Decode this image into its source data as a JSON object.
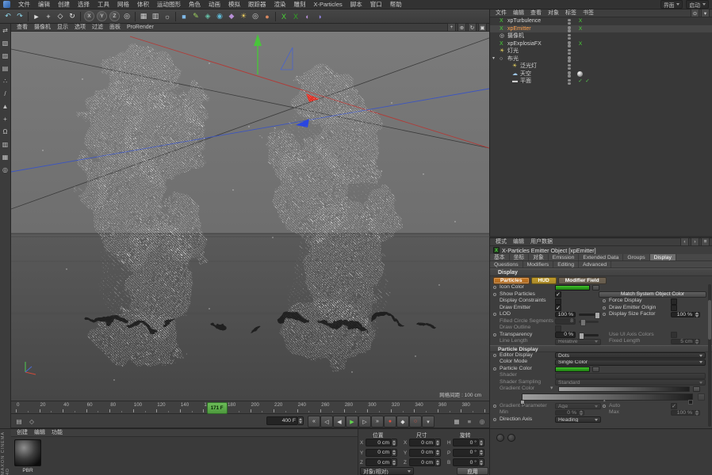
{
  "branding": "MAXON CINEMA 4D",
  "menubar": {
    "items": [
      "文件",
      "编辑",
      "创建",
      "选择",
      "工具",
      "网格",
      "体积",
      "运动图形",
      "角色",
      "动画",
      "模拟",
      "跟踪器",
      "渲染",
      "雕刻",
      "X-Particles",
      "脚本",
      "窗口",
      "帮助"
    ],
    "right": [
      {
        "label": "界面"
      },
      {
        "label": "启动"
      }
    ]
  },
  "toolbar": {
    "icons": [
      {
        "name": "undo-icon",
        "glyph": "↶",
        "color": "#8ed7ec"
      },
      {
        "name": "redo-icon",
        "glyph": "↷",
        "color": "#8ed7ec"
      },
      {
        "sep": true
      },
      {
        "name": "live-selection-icon",
        "glyph": "►",
        "color": "#dcdcdc"
      },
      {
        "name": "move-tool-icon",
        "glyph": "+",
        "color": "#e6e6e6"
      },
      {
        "name": "scale-tool-icon",
        "glyph": "◇",
        "color": "#e6e6e6"
      },
      {
        "name": "rotate-tool-icon",
        "glyph": "↻",
        "color": "#e6e6e6"
      },
      {
        "sep": true
      },
      {
        "name": "x-axis-lock-button",
        "glyph": "X",
        "round": true
      },
      {
        "name": "y-axis-lock-button",
        "glyph": "Y",
        "round": true
      },
      {
        "name": "z-axis-lock-button",
        "glyph": "Z",
        "round": true
      },
      {
        "name": "coordinate-system-button",
        "glyph": "◎",
        "color": "#d8d8d8"
      },
      {
        "sep": true
      },
      {
        "name": "render-view-button",
        "glyph": "▦",
        "color": "#cfcfcf"
      },
      {
        "name": "render-picture-viewer-button",
        "glyph": "▥",
        "color": "#cfcfcf"
      },
      {
        "name": "render-settings-button",
        "glyph": "☼",
        "color": "#cfcfcf"
      },
      {
        "sep": true
      },
      {
        "name": "add-cube-button",
        "glyph": "■",
        "color": "#7fb8e6"
      },
      {
        "name": "pen-spline-button",
        "glyph": "✎",
        "color": "#9fd45f"
      },
      {
        "name": "subdivision-surface-button",
        "glyph": "◈",
        "color": "#66c2a8"
      },
      {
        "name": "mograph-button",
        "glyph": "◉",
        "color": "#5fb8d4"
      },
      {
        "name": "deformer-button",
        "glyph": "◆",
        "color": "#b78fd6"
      },
      {
        "name": "environment-button",
        "glyph": "☀",
        "color": "#e8c95f"
      },
      {
        "name": "camera-button",
        "glyph": "◎",
        "color": "#cfcfcf"
      },
      {
        "name": "material-ball-button",
        "glyph": "●",
        "color": "#d8885f"
      },
      {
        "sep": true
      },
      {
        "name": "xparticles-emitter-button",
        "glyph": "X",
        "color": "#49d636"
      },
      {
        "name": "xparticles-system-button",
        "glyph": "X",
        "color": "#2fa823"
      },
      {
        "name": "cloth-button",
        "glyph": "◐",
        "color": "#b78fd6"
      },
      {
        "name": "volume-button",
        "glyph": "◑",
        "color": "#9183e0"
      }
    ]
  },
  "left_toolbar": {
    "icons": [
      {
        "name": "make-editable-icon",
        "glyph": "⇄"
      },
      {
        "name": "model-mode-icon",
        "glyph": "▧"
      },
      {
        "name": "texture-mode-icon",
        "glyph": "▨"
      },
      {
        "name": "workplane-mode-icon",
        "glyph": "▤"
      },
      {
        "name": "points-mode-icon",
        "glyph": "∴"
      },
      {
        "name": "edges-mode-icon",
        "glyph": "/"
      },
      {
        "name": "polygons-mode-icon",
        "glyph": "▲"
      },
      {
        "name": "axis-mode-icon",
        "glyph": "+"
      },
      {
        "name": "snap-toggle-icon",
        "glyph": "Ω"
      },
      {
        "name": "viewport-filter-icon",
        "glyph": "▥"
      },
      {
        "name": "grid-toggle-icon",
        "glyph": "▦"
      },
      {
        "name": "solo-mode-icon",
        "glyph": "◎"
      }
    ]
  },
  "viewport": {
    "menu": [
      "查看",
      "摄像机",
      "显示",
      "选项",
      "过滤",
      "面板",
      "ProRender"
    ],
    "corner_icons": [
      {
        "name": "pan-view-icon",
        "glyph": "+"
      },
      {
        "name": "zoom-view-icon",
        "glyph": "⊕"
      },
      {
        "name": "rotate-view-icon",
        "glyph": "↻"
      },
      {
        "name": "toggle-views-icon",
        "glyph": "▣"
      }
    ],
    "grid_label": "网格间距 : 100 cm"
  },
  "timeline": {
    "start": 0,
    "end": 400,
    "label_step": 20,
    "playhead": 171,
    "playhead_label": "171 F"
  },
  "transport": {
    "frame_field": "400 F",
    "left_icons": [
      {
        "name": "timeline-layout-icon",
        "glyph": "▤"
      },
      {
        "name": "marker-icon",
        "glyph": "◇"
      }
    ],
    "buttons": [
      {
        "name": "goto-start-button",
        "glyph": "«"
      },
      {
        "name": "previous-key-button",
        "glyph": "◁"
      },
      {
        "name": "previous-frame-button",
        "glyph": "◀"
      },
      {
        "name": "play-button",
        "glyph": "▶",
        "color": "#62d44e"
      },
      {
        "name": "next-frame-button",
        "glyph": "▷"
      },
      {
        "name": "goto-end-button",
        "glyph": "»"
      },
      {
        "name": "record-keyframe-button",
        "glyph": "●",
        "color": "#e05040"
      },
      {
        "name": "keyframe-selection-button",
        "glyph": "◆",
        "color": "#d8d8d8"
      },
      {
        "name": "autokey-button",
        "glyph": "○",
        "color": "#e05040"
      },
      {
        "name": "playback-options-button",
        "glyph": "▾",
        "color": "#c8c8c8"
      }
    ],
    "right_icons": [
      {
        "name": "sound-icon",
        "glyph": "▦"
      },
      {
        "name": "playback-rate-icon",
        "glyph": "≡"
      },
      {
        "name": "hud-icon",
        "glyph": "◎"
      }
    ]
  },
  "object_manager": {
    "menu": [
      "文件",
      "编辑",
      "查看",
      "对象",
      "标签",
      "书签"
    ],
    "objects": [
      {
        "name": "xpTurbulence",
        "icon": "xp",
        "tags": [
          "xp"
        ]
      },
      {
        "name": "xpEmitter",
        "icon": "xp",
        "selected": true,
        "tags": [
          "xp"
        ]
      },
      {
        "name": "摄像机",
        "icon": "camera",
        "tags": []
      },
      {
        "name": "xpExplosiaFX",
        "icon": "xp",
        "tags": [
          "xp"
        ]
      },
      {
        "name": "灯光",
        "icon": "light",
        "tags": []
      },
      {
        "name": "布光",
        "icon": "null",
        "folder": true,
        "tags": []
      },
      {
        "name": "泛光灯",
        "icon": "light",
        "indent": 1,
        "tags": []
      },
      {
        "name": "天空",
        "icon": "sky",
        "indent": 1,
        "tags": [
          "material"
        ]
      },
      {
        "name": "平面",
        "icon": "plane",
        "indent": 1,
        "tags": [
          "check",
          "check"
        ]
      }
    ]
  },
  "attribute_manager": {
    "menu": [
      "模式",
      "编辑",
      "用户数据"
    ],
    "title": "X-Particles Emitter Object [xpEmitter]",
    "tabs_row1": [
      "基本",
      "坐标",
      "对象",
      "Emission",
      "Extended Data",
      "Groups",
      "Display"
    ],
    "tabs_row2": [
      "Questions",
      "Modifiers",
      "Editing",
      "Advanced"
    ],
    "active_tab": "Display",
    "section_title": "Display",
    "subtabs": [
      {
        "label": "Particles",
        "color": "#c8761f",
        "active": true
      },
      {
        "label": "HUD",
        "color": "#c09a28"
      },
      {
        "label": "Modifier Field",
        "color": "#6f6352"
      }
    ],
    "params": [
      {
        "l": {
          "circle": true,
          "label": "Icon Color",
          "control": "color",
          "value": "#3fc32b"
        }
      },
      {
        "l": {
          "circle": true,
          "label": "Show Particles",
          "control": "check",
          "checked": true
        },
        "r": {
          "control": "button",
          "label": "Match System Object Color"
        }
      },
      {
        "l": {
          "label": "Display Constraints",
          "control": "check",
          "checked": false
        },
        "r": {
          "circle": true,
          "label": "Force Display",
          "control": "check",
          "checked": false
        }
      },
      {
        "l": {
          "label": "Draw Emitter",
          "control": "check",
          "checked": true
        },
        "r": {
          "circle": true,
          "label": "Draw Emitter Origin",
          "control": "check",
          "checked": false
        }
      },
      {
        "l": {
          "circle": true,
          "label": "LOD",
          "control": "slider",
          "value": "100 %",
          "pct": 100
        },
        "r": {
          "circle": true,
          "label": "Display Size Factor",
          "control": "spin",
          "value": "100 %"
        }
      },
      {
        "l": {
          "label": "Filled Circle Segments",
          "control": "slider",
          "value": "8",
          "pct": 12,
          "disabled": true
        }
      },
      {
        "l": {
          "label": "Draw Outline",
          "control": "check",
          "checked": false,
          "disabled": true
        }
      },
      {
        "l": {
          "circle": true,
          "label": "Transparency",
          "control": "slider",
          "value": "0 %",
          "pct": 0
        },
        "r": {
          "label": "Use UI Axis Colors",
          "control": "check",
          "checked": false,
          "disabled": true
        }
      },
      {
        "l": {
          "label": "Line Length",
          "control": "dropdown",
          "value": "Relative",
          "disabled": true
        },
        "r": {
          "label": "Fixed Length",
          "control": "spin",
          "value": "5 cm",
          "disabled": true
        }
      },
      {
        "section": "Particle Display"
      },
      {
        "l": {
          "circle": true,
          "label": "Editor Display",
          "control": "dropdown",
          "value": "Dots",
          "wide": true
        }
      },
      {
        "l": {
          "label": "Color Mode",
          "control": "dropdown",
          "value": "Single Color",
          "wide": true
        }
      },
      {
        "l": {
          "circle": true,
          "label": "Particle Color",
          "control": "color",
          "value": "#3fc32b"
        }
      },
      {
        "l": {
          "label": "Shader",
          "control": "texture",
          "value": "",
          "disabled": true,
          "wide": true
        }
      },
      {
        "l": {
          "label": "Shader Sampling",
          "control": "dropdown",
          "value": "Standard",
          "disabled": true,
          "wide": true
        }
      },
      {
        "l": {
          "label": "Gradient Color",
          "control": "gradient",
          "disabled": true
        }
      },
      {
        "strip": true
      },
      {
        "l": {
          "circle": true,
          "label": "Gradient Parameter",
          "control": "dropdown",
          "value": "Age",
          "disabled": true
        },
        "r": {
          "circle": true,
          "label": "Auto",
          "control": "check",
          "checked": true,
          "disabled": true
        }
      },
      {
        "l": {
          "label": "Min",
          "control": "spin",
          "value": "0 %",
          "disabled": true
        },
        "r": {
          "label": "Max",
          "control": "spin",
          "value": "100 %",
          "disabled": true
        }
      },
      {
        "l": {
          "circle": true,
          "label": "Direction Axis",
          "control": "dropdown",
          "value": "Heading"
        }
      }
    ]
  },
  "materials": {
    "menu": [
      "创建",
      "编辑",
      "功能"
    ],
    "items": [
      {
        "name": "PBR"
      }
    ]
  },
  "coordinates": {
    "columns": [
      {
        "title": "位置",
        "rows": [
          {
            "axis": "X",
            "value": "0 cm"
          },
          {
            "axis": "Y",
            "value": "0 cm"
          },
          {
            "axis": "Z",
            "value": "0 cm"
          }
        ]
      },
      {
        "title": "尺寸",
        "rows": [
          {
            "axis": "X",
            "value": "0 cm"
          },
          {
            "axis": "Y",
            "value": "0 cm"
          },
          {
            "axis": "Z",
            "value": "0 cm"
          }
        ]
      },
      {
        "title": "旋转",
        "rows": [
          {
            "axis": "H",
            "value": "0 °"
          },
          {
            "axis": "P",
            "value": "0 °"
          },
          {
            "axis": "B",
            "value": "0 °"
          }
        ]
      }
    ],
    "mode": "对象(相对)",
    "apply": "应用"
  }
}
